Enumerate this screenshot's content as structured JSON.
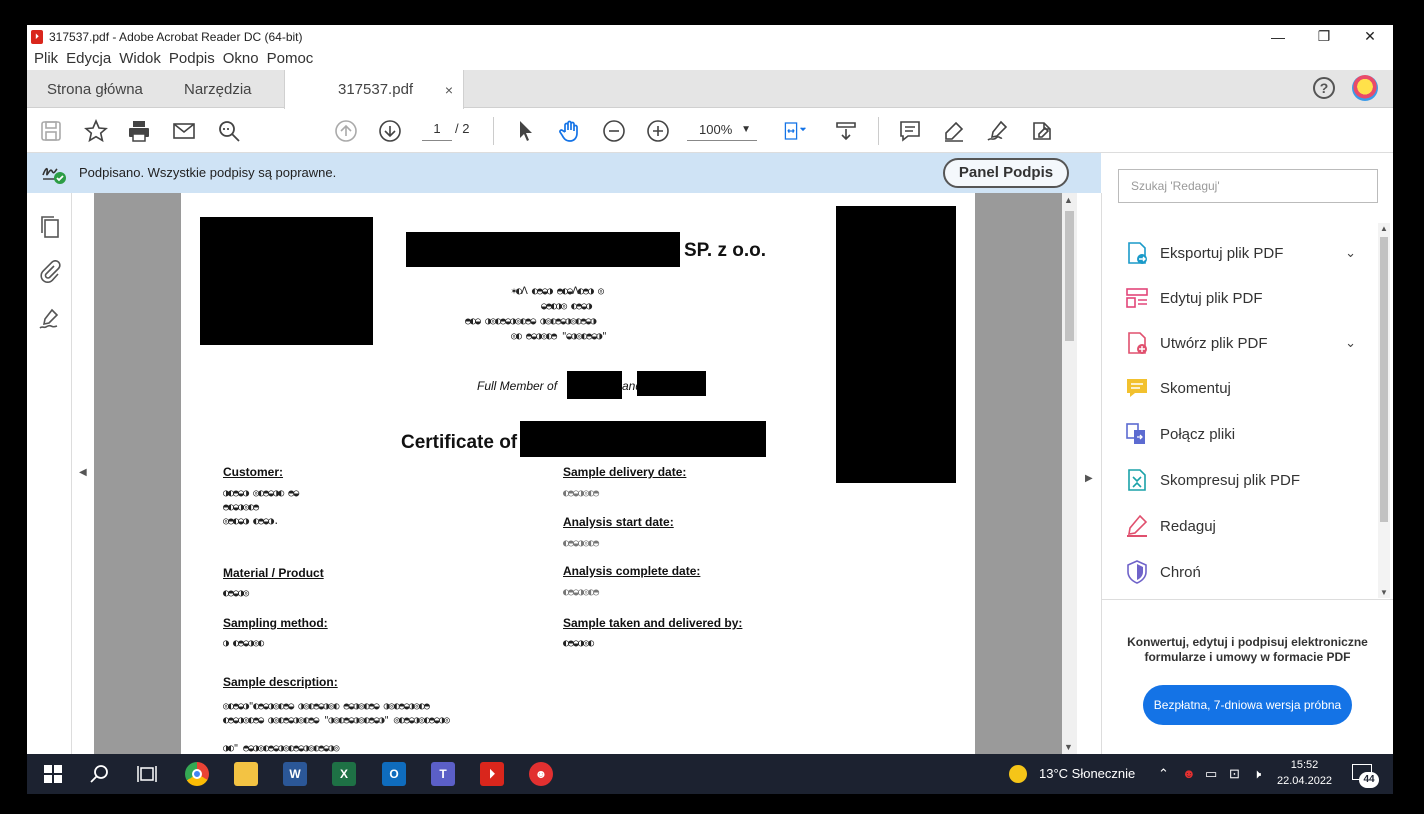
{
  "window": {
    "title": "317537.pdf - Adobe Acrobat Reader DC (64-bit)",
    "controls": {
      "minimize": "—",
      "restore": "❐",
      "close": "✕"
    }
  },
  "menu": [
    "Plik",
    "Edycja",
    "Widok",
    "Podpis",
    "Okno",
    "Pomoc"
  ],
  "tabs": {
    "home": "Strona główna",
    "tools": "Narzędzia",
    "document": "317537.pdf",
    "close": "×"
  },
  "help": "?",
  "toolbar": {
    "page_current": "1",
    "page_total": "/ 2",
    "zoom": "100%"
  },
  "signature_bar": {
    "message": "Podpisano. Wszystkie podpisy są poprawne.",
    "panel_button": "Panel Podpis"
  },
  "document": {
    "company_suffix": "SP. z o.o.",
    "member_prefix": "Full Member of",
    "member_and": "and",
    "cert_title": "Certificate of",
    "labels": {
      "customer": "Customer:",
      "sample_delivery": "Sample delivery date:",
      "analysis_start": "Analysis start date:",
      "material": "Material / Product",
      "analysis_complete": "Analysis complete date:",
      "sampling_method": "Sampling method:",
      "sample_taken": "Sample taken and delivered by:",
      "sample_description": "Sample description:"
    }
  },
  "right_pane": {
    "search_placeholder": "Szukaj 'Redaguj'",
    "tools": [
      {
        "label": "Eksportuj plik PDF",
        "color": "#1a9ac9",
        "expandable": true
      },
      {
        "label": "Edytuj plik PDF",
        "color": "#e2467a",
        "expandable": false
      },
      {
        "label": "Utwórz plik PDF",
        "color": "#e0506e",
        "expandable": true
      },
      {
        "label": "Skomentuj",
        "color": "#f2c12e",
        "expandable": false
      },
      {
        "label": "Połącz pliki",
        "color": "#5c6bd1",
        "expandable": false
      },
      {
        "label": "Skompresuj plik PDF",
        "color": "#1aa2a8",
        "expandable": false
      },
      {
        "label": "Redaguj",
        "color": "#e0506e",
        "expandable": false
      },
      {
        "label": "Chroń",
        "color": "#6f63c9",
        "expandable": false
      }
    ],
    "promo_text": "Konwertuj, edytuj i podpisuj elektroniczne formularze i umowy w formacie PDF",
    "trial_button": "Bezpłatna, 7-dniowa wersja próbna"
  },
  "taskbar": {
    "weather": "13°C  Słonecznie",
    "time": "15:52",
    "date": "22.04.2022",
    "notifications": "44"
  }
}
